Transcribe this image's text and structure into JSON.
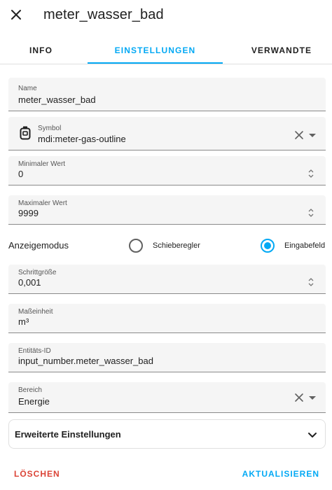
{
  "header": {
    "title": "meter_wasser_bad"
  },
  "tabs": [
    {
      "label": "INFO"
    },
    {
      "label": "EINSTELLUNGEN"
    },
    {
      "label": "VERWANDTE"
    }
  ],
  "fields": {
    "name": {
      "label": "Name",
      "value": "meter_wasser_bad"
    },
    "symbol": {
      "label": "Symbol",
      "value": "mdi:meter-gas-outline"
    },
    "min": {
      "label": "Minimaler Wert",
      "value": "0"
    },
    "max": {
      "label": "Maximaler Wert",
      "value": "9999"
    },
    "step": {
      "label": "Schrittgröße",
      "value": "0,001"
    },
    "unit": {
      "label": "Maßeinheit",
      "value": "m³"
    },
    "entity_id": {
      "label": "Entitäts-ID",
      "value": "input_number.meter_wasser_bad"
    },
    "area": {
      "label": "Bereich",
      "value": "Energie"
    }
  },
  "mode": {
    "label": "Anzeigemodus",
    "options": [
      {
        "label": "Schieberegler",
        "checked": false
      },
      {
        "label": "Eingabefeld",
        "checked": true
      }
    ]
  },
  "advanced": {
    "label": "Erweiterte Einstellungen"
  },
  "actions": {
    "delete": "LÖSCHEN",
    "update": "AKTUALISIEREN"
  },
  "colors": {
    "accent": "#03a9f4",
    "danger": "#db4437"
  }
}
